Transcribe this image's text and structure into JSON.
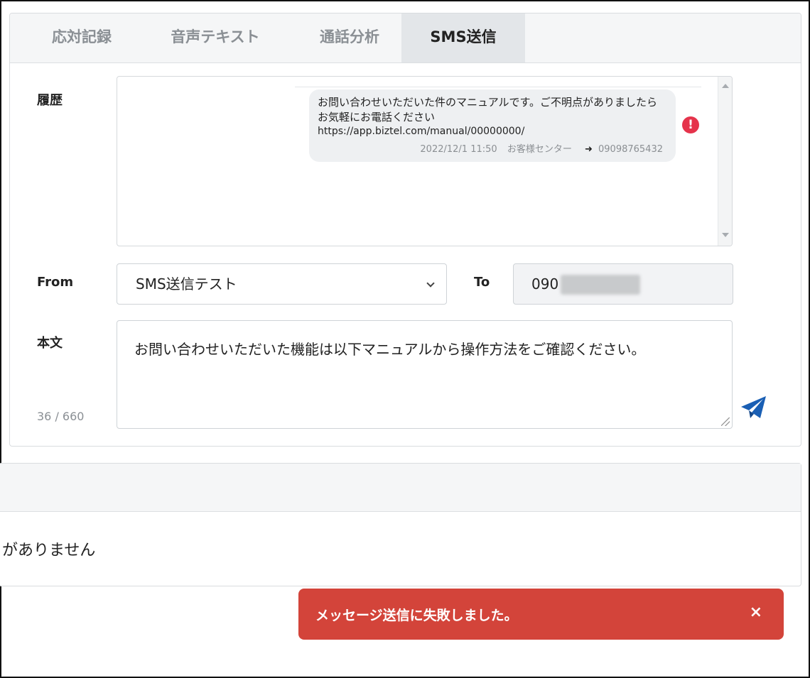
{
  "tabs": [
    {
      "label": "応対記録",
      "active": false
    },
    {
      "label": "音声テキスト",
      "active": false
    },
    {
      "label": "通話分析",
      "active": false
    },
    {
      "label": "SMS送信",
      "active": true
    }
  ],
  "history": {
    "label": "履歴",
    "message": {
      "text": "お問い合わせいただいた件のマニュアルです。ご不明点がありましたらお気軽にお電話ください",
      "url": "https://app.biztel.com/manual/00000000/",
      "timestamp": "2022/12/1 11:50",
      "sender": "お客様センター",
      "recipient": "09098765432",
      "status_icon": "error-icon"
    }
  },
  "form": {
    "from_label": "From",
    "from_value": "SMS送信テスト",
    "to_label": "To",
    "to_value": "090",
    "body_label": "本文",
    "body_value": "お問い合わせいただいた機能は以下マニュアルから操作方法をご確認ください。",
    "char_count": "36 / 660",
    "send_icon": "send-icon"
  },
  "lower_panel": {
    "text": "がありません"
  },
  "toast": {
    "message": "メッセージ送信に失敗しました。",
    "close": "×",
    "color": "#d3443a"
  }
}
